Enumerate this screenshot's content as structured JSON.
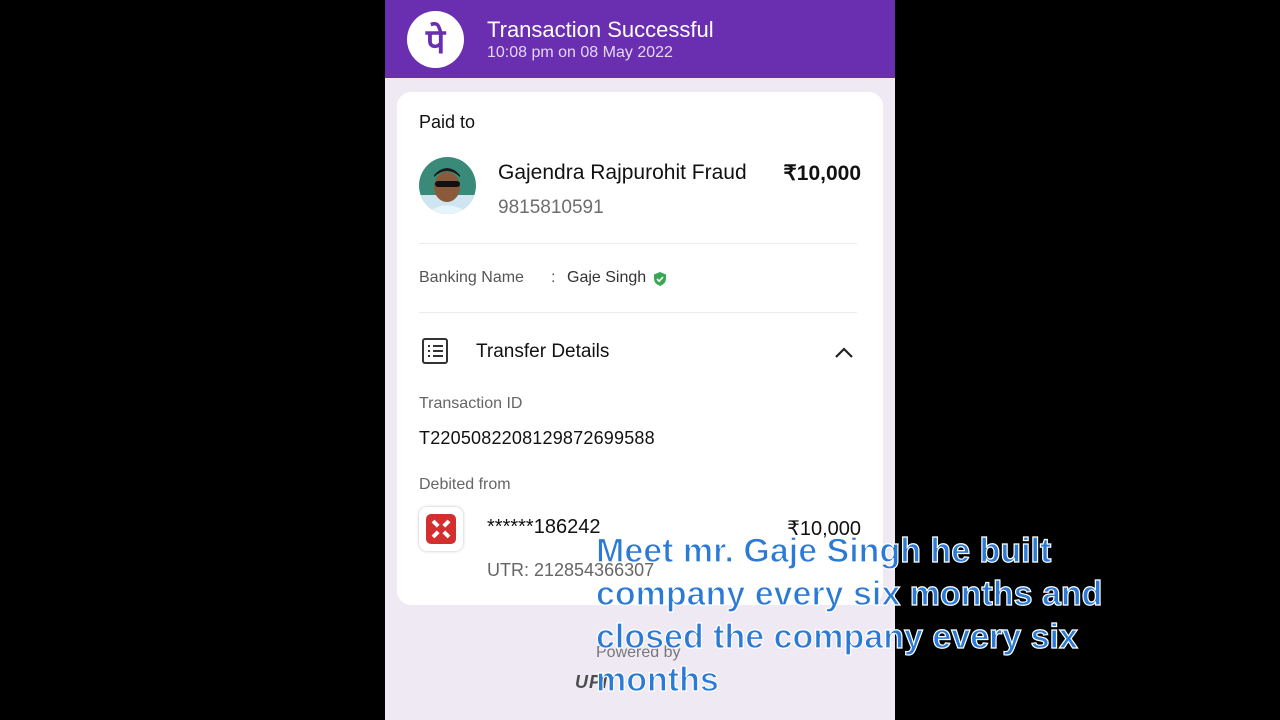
{
  "header": {
    "logo_glyph": "पे",
    "title": "Transaction Successful",
    "subtitle": "10:08 pm on 08 May 2022",
    "bg_color": "#6a2fb0"
  },
  "paid_to": {
    "label": "Paid to",
    "name": "Gajendra Rajpurohit Fraud",
    "amount": "₹10,000",
    "phone": "9815810591"
  },
  "banking": {
    "label": "Banking Name",
    "colon": ":",
    "value": "Gaje Singh",
    "verified_icon": "verified-shield-icon"
  },
  "transfer_details": {
    "title": "Transfer Details",
    "transaction_id_label": "Transaction ID",
    "transaction_id": "T2205082208129872699588",
    "debited_from_label": "Debited from",
    "account": "******186242",
    "amount": "₹10,000",
    "utr": "UTR: 212854366307"
  },
  "footer": {
    "powered_by": "Powered by",
    "upi_logo": "UPI"
  },
  "caption": "Meet mr. Gaje Singh he built company every six months and closed the company every six months"
}
